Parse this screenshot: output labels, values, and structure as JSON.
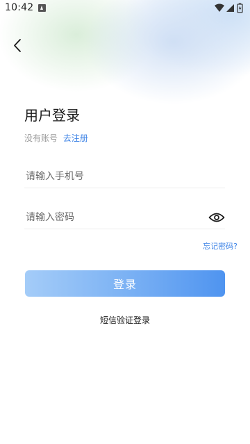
{
  "status_bar": {
    "time": "10:42",
    "notification_icon": "app-notification-icon",
    "icons": [
      "wifi-icon",
      "cellular-signal-icon",
      "battery-charging-icon"
    ]
  },
  "nav": {
    "back_icon": "chevron-left-icon"
  },
  "login": {
    "title": "用户登录",
    "no_account_text": "没有账号",
    "register_link": "去注册",
    "phone_placeholder": "请输入手机号",
    "password_placeholder": "请输入密码",
    "password_visibility_icon": "eye-icon",
    "forgot_password": "忘记密码?",
    "login_button": "登录",
    "sms_login": "短信验证登录"
  },
  "colors": {
    "accent": "#3b82e6",
    "button_gradient_start": "#a4ccf8",
    "button_gradient_end": "#4f94f0",
    "placeholder": "#6b6b6b",
    "muted_text": "#9a9a9a"
  }
}
